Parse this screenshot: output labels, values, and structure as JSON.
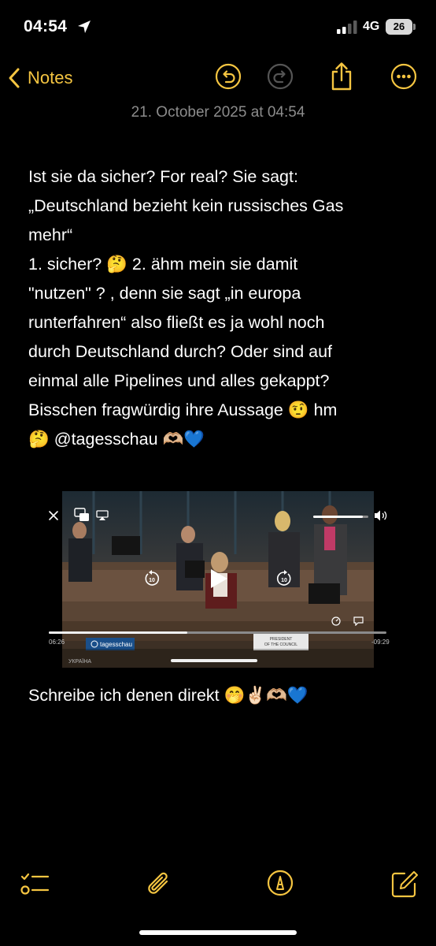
{
  "status_bar": {
    "time": "04:54",
    "network": "4G",
    "battery": "26"
  },
  "nav": {
    "back_label": "Notes"
  },
  "note": {
    "date": "21. October 2025 at 04:54",
    "paragraph1_lines": [
      "Ist sie da sicher? For real? Sie sagt:",
      "„Deutschland bezieht kein russisches Gas",
      "mehr“",
      "1. sicher? 🤔 2. ähm mein sie damit",
      "\"nutzen\" ? , denn sie sagt „in europa",
      "runterfahren“ also fließt es ja wohl noch",
      "durch Deutschland durch? Oder sind auf",
      "einmal alle Pipelines und alles gekappt?",
      "Bisschen fragwürdig ihre Aussage 🤨 hm",
      "🤔 @tagesschau 🫶🏼💙"
    ],
    "line2": "Schreibe ich denen direkt 🤭✌🏻🫶🏼💙"
  },
  "video": {
    "elapsed": "06:26",
    "remaining": "-09:29",
    "progress": 0.41,
    "volume": 0.9,
    "skip_seconds": "10",
    "channel": "tagesschau",
    "country_caption": "УКРАЇНА",
    "sign_text": "PRESIDENT OF THE COUNCIL"
  }
}
